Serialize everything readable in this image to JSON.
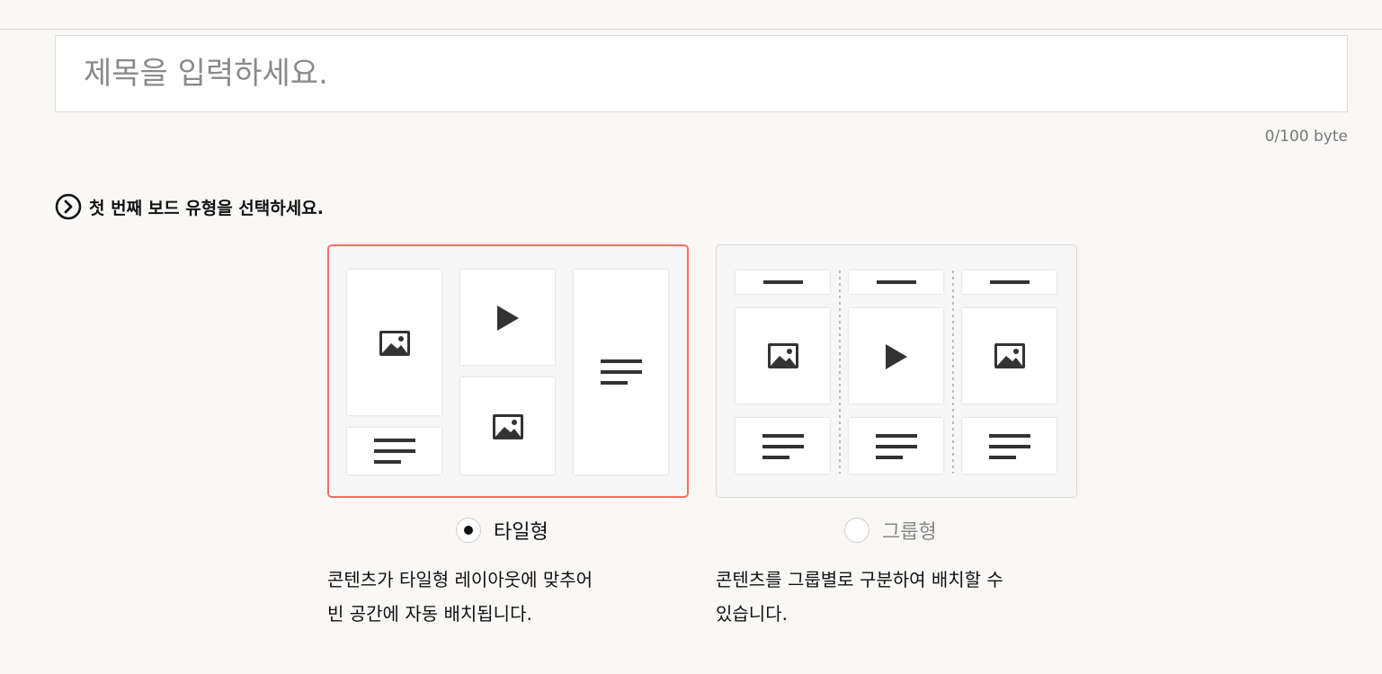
{
  "title_field": {
    "placeholder": "제목을 입력하세요.",
    "byte_counter": "0/100 byte"
  },
  "board_type_section": {
    "heading": "첫 번째 보드 유형을 선택하세요.",
    "heading_icon": "chevron-right-circle-icon",
    "selected_option": "tile",
    "options": [
      {
        "id": "tile",
        "label": "타일형",
        "selected": true,
        "description_line1": "콘텐츠가 타일형 레이아웃에 맞추어",
        "description_line2": "빈 공간에 자동 배치됩니다."
      },
      {
        "id": "group",
        "label": "그룹형",
        "selected": false,
        "description_line1": "콘텐츠를 그룹별로 구분하여 배치할 수",
        "description_line2": "있습니다."
      }
    ]
  },
  "colors": {
    "background": "#f9f8f6",
    "selected_border": "#ef7162",
    "unselected_border": "#d9d9d9",
    "icon_dark": "#333333"
  }
}
